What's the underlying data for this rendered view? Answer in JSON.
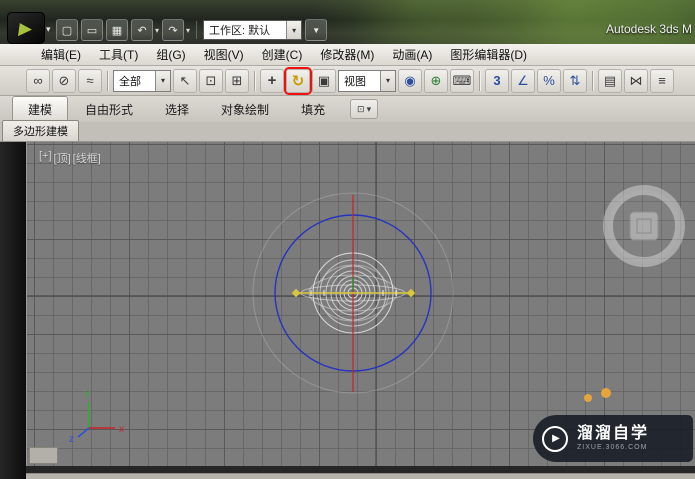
{
  "titlebar": {
    "app_title": "Autodesk 3ds M",
    "workspace_label": "工作区: 默认"
  },
  "menu": {
    "items": [
      "编辑(E)",
      "工具(T)",
      "组(G)",
      "视图(V)",
      "创建(C)",
      "修改器(M)",
      "动画(A)",
      "图形编辑器(D)"
    ]
  },
  "toolbar": {
    "selection_filter_value": "全部",
    "reference_coordsys_value": "视图"
  },
  "ribbon": {
    "tabs": [
      "建模",
      "自由形式",
      "选择",
      "对象绘制",
      "填充"
    ],
    "active_tab": "建模",
    "subtab": "多边形建模"
  },
  "viewport": {
    "label_plus": "[+]",
    "label_view": "[顶]",
    "label_shading": "[线框]",
    "axes": {
      "x": "x",
      "y": "Y",
      "z": "z"
    }
  },
  "watermark": {
    "title": "溜溜自学",
    "url": "zixue.3066.com"
  },
  "icons": {
    "logo": "▶",
    "caret_down": "▾",
    "flag_down": "▼",
    "new_file": "▢",
    "open_file": "▭",
    "save_file": "▦",
    "undo": "↶",
    "redo": "↷",
    "link": "∞",
    "unlink": "⊘",
    "bind_spacewarp": "≈",
    "select_object": "↖",
    "selection_region": "⊡",
    "window_crossing": "⊞",
    "move": "+",
    "rotate": "↻",
    "scale": "▣",
    "pivot_center": "◉",
    "manipulate": "⊕",
    "keyboard_override": "⌨",
    "snap_3d": "3",
    "angle_snap": "∠",
    "percent_snap": "%",
    "spinner_snap": "⇅",
    "named_sets": "▤",
    "mirror": "⋈",
    "align": "≡",
    "ribbon_more": "⊡",
    "play": "▶"
  },
  "colors": {
    "annotation_highlight": "#ee1111",
    "viewport_bg": "#7c7c7c",
    "circle_blue": "#2433c0",
    "axis_red": "#cc2222",
    "spline_yellow": "#d9c93a",
    "axis_green": "#2e8b2e"
  }
}
